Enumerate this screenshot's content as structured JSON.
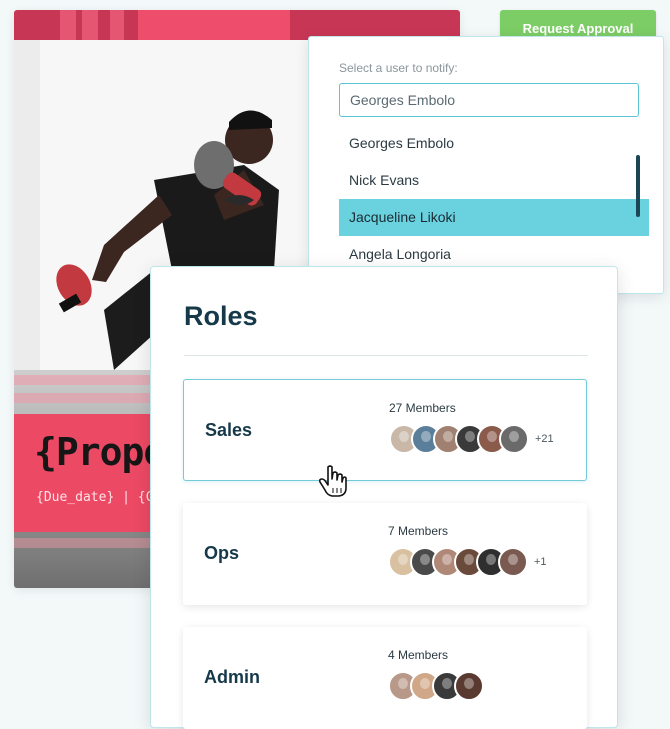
{
  "toolbar": {
    "request_label": "Request Approval"
  },
  "notify": {
    "label": "Select a user to notify:",
    "input_value": "Georges Embolo",
    "options": [
      {
        "label": "Georges Embolo",
        "selected": false
      },
      {
        "label": "Nick Evans",
        "selected": false
      },
      {
        "label": "Jacqueline Likoki",
        "selected": true
      },
      {
        "label": "Angela Longoria",
        "selected": false
      }
    ]
  },
  "proposal": {
    "title": "{Propo",
    "subtitle": "{Due_date} | {C"
  },
  "roles": {
    "title": "Roles",
    "items": [
      {
        "name": "Sales",
        "members": "27 Members",
        "more": "+21",
        "active": true,
        "avatars": [
          "#c9b8a8",
          "#5b7f9a",
          "#a08070",
          "#3a3a3a",
          "#8a5a4a",
          "#6a6a6a"
        ]
      },
      {
        "name": "Ops",
        "members": "7 Members",
        "more": "+1",
        "active": false,
        "avatars": [
          "#d8c0a0",
          "#4a4a4a",
          "#b08878",
          "#6a4a3a",
          "#2f2f2f",
          "#7a5a50"
        ]
      },
      {
        "name": "Admin",
        "members": "4 Members",
        "more": "",
        "active": false,
        "avatars": [
          "#b89888",
          "#d0a888",
          "#3a3a3a",
          "#5a3a30"
        ]
      }
    ]
  },
  "colors": {
    "accent": "#6ad1df",
    "approve_green": "#7ccd66",
    "brand_red": "#ec4964",
    "heading": "#16394a"
  }
}
